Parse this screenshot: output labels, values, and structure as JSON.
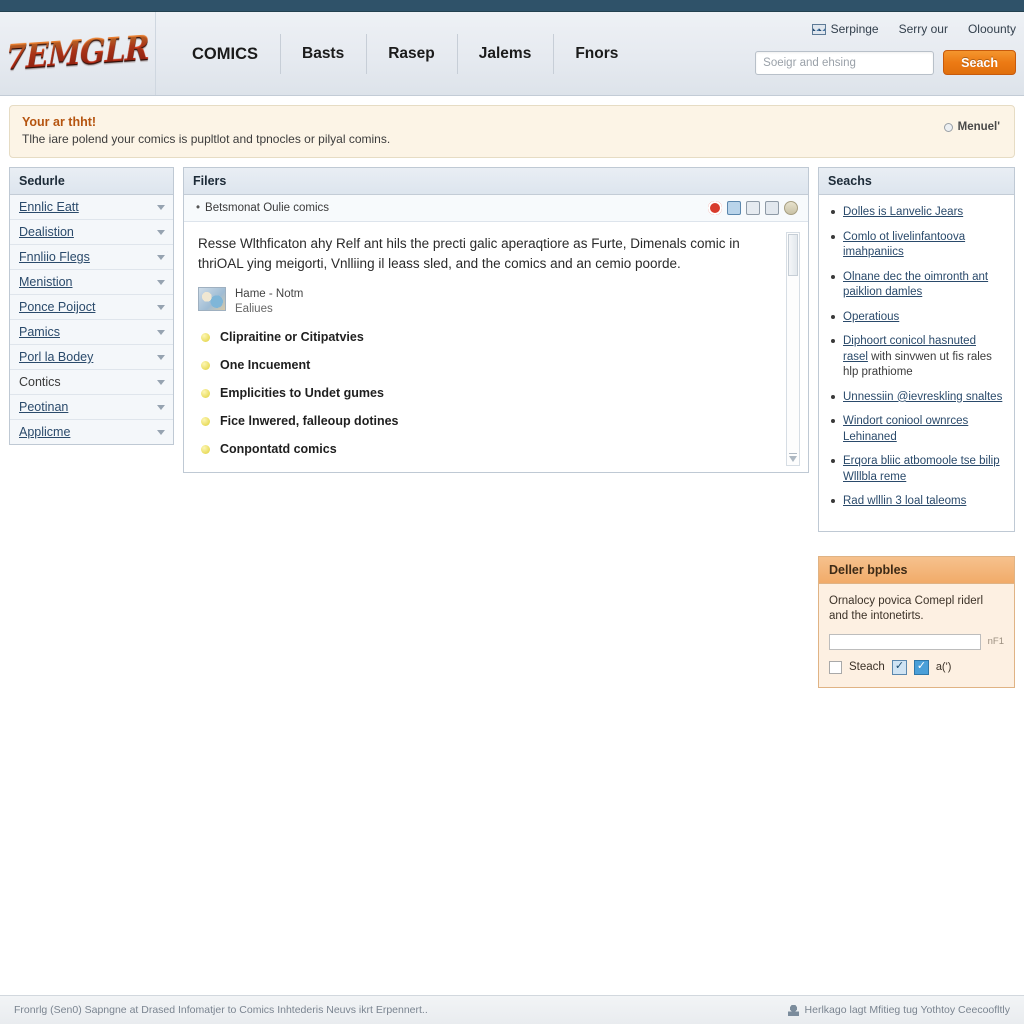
{
  "brand": {
    "logo_text": "7EMGLR"
  },
  "header": {
    "nav": [
      {
        "label": "COMICS"
      },
      {
        "label": "Basts"
      },
      {
        "label": "Rasep"
      },
      {
        "label": "Jalems"
      },
      {
        "label": "Fnors"
      }
    ],
    "utility": [
      {
        "label": "Serpinge",
        "icon": "flag-icon"
      },
      {
        "label": "Serry our",
        "icon": ""
      },
      {
        "label": "Oloounty",
        "icon": ""
      }
    ],
    "search": {
      "placeholder": "Soeigr and ehsing",
      "value": "",
      "button_label": "Seach"
    }
  },
  "notice": {
    "title": "Your ar thht!",
    "body": "Tlhe iare polend your comics is pupltlot and tpnocles or pilyal comins.",
    "action_label": "Menuel'"
  },
  "sidebar": {
    "title": "Sedurle",
    "items": [
      {
        "label": "Ennlic Eatt",
        "caret": true,
        "link": true
      },
      {
        "label": "Dealistion",
        "caret": true,
        "link": true
      },
      {
        "label": "Fnnliio Flegs",
        "caret": true,
        "link": true
      },
      {
        "label": "Menistion",
        "caret": true,
        "link": true
      },
      {
        "label": "Ponce Poijoct",
        "caret": true,
        "link": true
      },
      {
        "label": "Pamics",
        "caret": true,
        "link": true
      },
      {
        "label": "Porl la Bodey",
        "caret": true,
        "link": true
      },
      {
        "label": "Contics",
        "caret": true,
        "link": false
      },
      {
        "label": "Peotinan",
        "caret": true,
        "link": true
      },
      {
        "label": "Applicme",
        "caret": true,
        "link": true
      }
    ]
  },
  "main": {
    "title": "Filers",
    "breadcrumb": "Betsmonat Oulie comics",
    "tools": [
      {
        "name": "record-icon"
      },
      {
        "name": "save-icon"
      },
      {
        "name": "note-icon"
      },
      {
        "name": "image-icon"
      },
      {
        "name": "upload-icon"
      }
    ],
    "lead": "Resse Wlthficaton ahy Relf ant hils the precti galic aperaqtiore as Furte, Dimenals comic in thriOAL ying meigorti, Vnlliing il leass sled, and the comics and an cemio poorde.",
    "media": {
      "line1": "Hame - Notm",
      "line2": "Ealiues"
    },
    "bullets": [
      {
        "label": "Clipraitine or Citipatvies"
      },
      {
        "label": "One Incuement"
      },
      {
        "label": "Emplicities to Undet gumes"
      },
      {
        "label": "Fice lnwered, falleoup dotines"
      },
      {
        "label": "Conpontatd comics"
      }
    ]
  },
  "right": {
    "title": "Seachs",
    "links": [
      {
        "text": "Dolles is Lanvelic Jears"
      },
      {
        "text": "Comlo ot livelinfantoova imahpaniics"
      },
      {
        "text": "Olnane dec the oimronth ant paiklion damles"
      },
      {
        "text": "Operatious"
      },
      {
        "text": "Diphoort conicol hasnuted rasel",
        "tail": "with sinvwen ut fis rales hlp prathiome"
      },
      {
        "text": "Unnessiin @ievreskling snaltes"
      },
      {
        "text": "Windort coniool ownrces Lehinaned"
      },
      {
        "text": "Erqora bliic atbomoole tse bilip Wlllbla reme"
      },
      {
        "text": "Rad wlllin 3 loal taleoms"
      }
    ]
  },
  "promo": {
    "title": "Deller bpbles",
    "body": "Ornalocy povica Comepl riderl and the intonetirts.",
    "input_value": "",
    "input_hint": "nF1",
    "checkbox_label": "Steach",
    "trailing_label": "a(')"
  },
  "footer": {
    "left": "Fronrlg (Sen0) Sapngne at Drased Infomatjer to Comics Inhtederis Neuvs ikrt Erpennert..",
    "right": "Herlkago lagt Mfitieg tug Yothtoy Ceecoofltly"
  },
  "colors": {
    "topbar": "#2f5269",
    "accent_orange": "#ec7a14",
    "link_blue": "#2a4a6b",
    "notice_bg": "#fcf4e6",
    "notice_title": "#b5540f",
    "promo_head": "#f1ab69"
  }
}
